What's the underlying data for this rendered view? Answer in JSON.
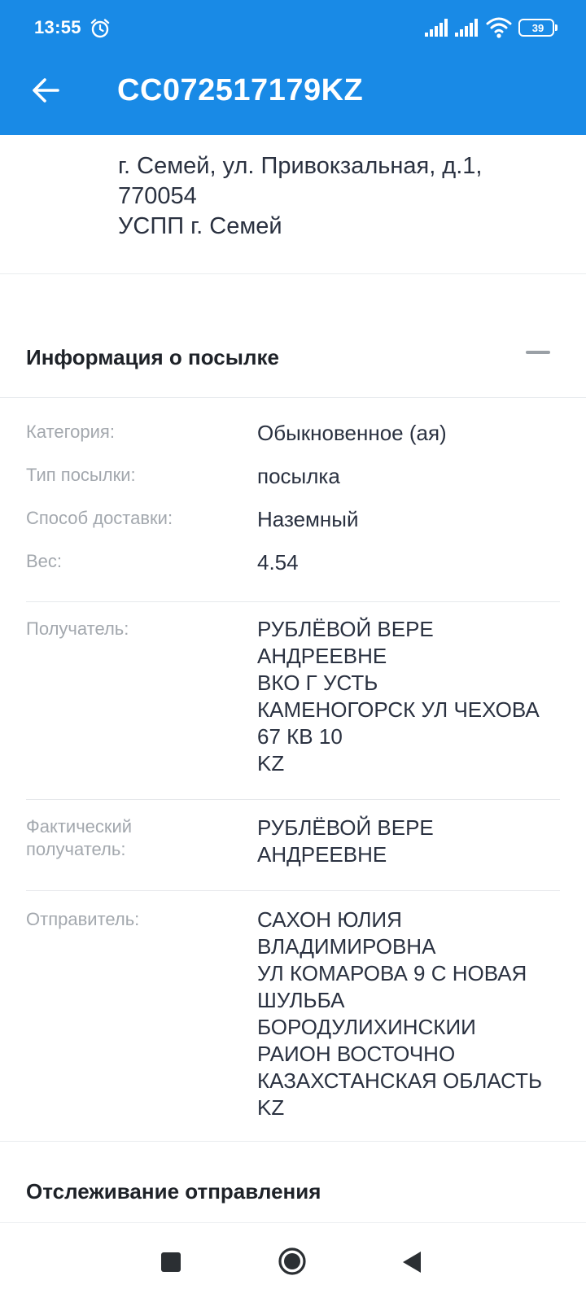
{
  "status_bar": {
    "time": "13:55",
    "battery_level": "39",
    "icons": [
      "alarm-icon",
      "signal-icon",
      "signal-icon",
      "wifi-icon",
      "battery-icon"
    ]
  },
  "app_bar": {
    "title": "CC072517179KZ",
    "back_icon": "arrow-left-icon"
  },
  "office_address": {
    "lines": "г. Семей, ул. Привокзальная, д.1,\n770054\nУСПП г. Семей"
  },
  "parcel_info": {
    "title": "Информация о посылке",
    "rows": [
      {
        "label": "Категория:",
        "value": "Обыкновенное (ая)"
      },
      {
        "label": "Тип посылки:",
        "value": "посылка"
      },
      {
        "label": "Способ доставки:",
        "value": "Наземный"
      },
      {
        "label": "Вес:",
        "value": "4.54"
      }
    ],
    "recipient": {
      "label": "Получатель:",
      "value": "РУБЛЁВОЙ  ВЕРЕ\nАНДРЕЕВНЕ\nВКО  Г  УСТЬ\nКАМЕНОГОРСК  УЛ ЧЕХОВА\n67 КВ 10\nKZ"
    },
    "actual_recipient": {
      "label": "Фактический\nполучатель:",
      "value": "РУБЛЁВОЙ  ВЕРЕ\nАНДРЕЕВНЕ"
    },
    "sender": {
      "label": "Отправитель:",
      "value": "САХОН ЮЛИЯ\nВЛАДИМИРОВНА\nУЛ КОМАРОВА 9 С НОВАЯ\nШУЛЬБА\nБОРОДУЛИХИНСКИИ\nРАИОН ВОСТОЧНО\nКАЗАХСТАНСКАЯ ОБЛАСТЬ\nKZ"
    }
  },
  "tracking": {
    "title": "Отслеживание отправления"
  },
  "nav_bar": {
    "icons": [
      "recents-icon",
      "home-icon",
      "back-icon"
    ]
  },
  "colors": {
    "primary": "#198ae6",
    "label": "#a3a8ae",
    "text": "#2a3140"
  }
}
